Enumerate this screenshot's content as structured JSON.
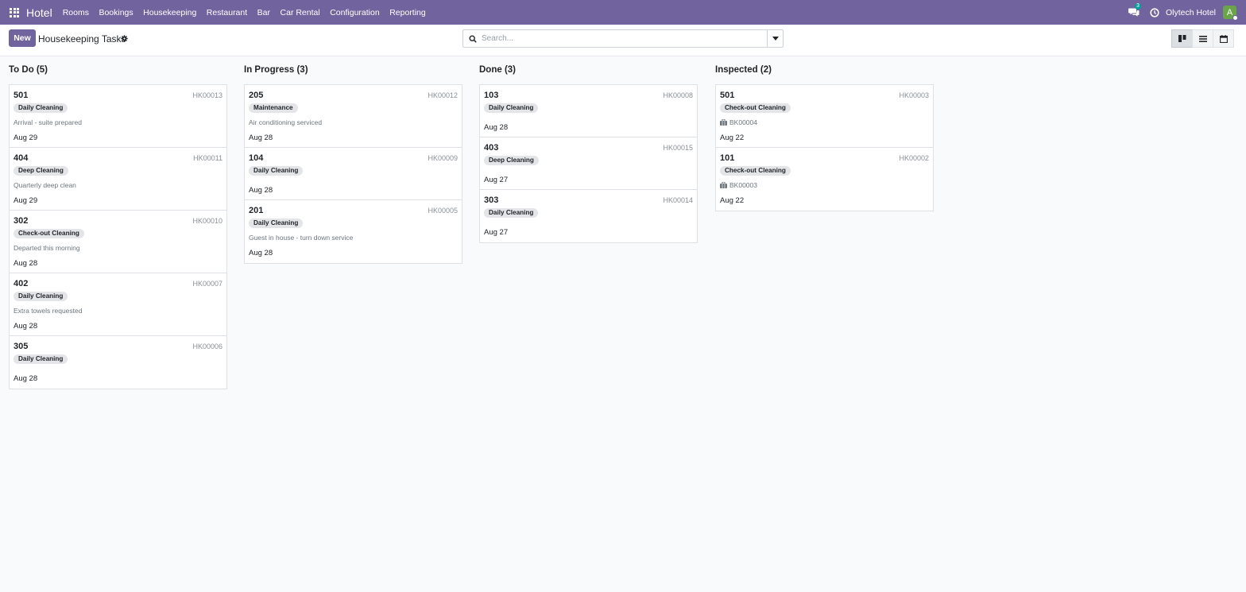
{
  "navbar": {
    "brand": "Hotel",
    "menu": [
      "Rooms",
      "Bookings",
      "Housekeeping",
      "Restaurant",
      "Bar",
      "Car Rental",
      "Configuration",
      "Reporting"
    ],
    "message_count": "3",
    "company": "Olytech Hotel",
    "avatar_letter": "A"
  },
  "control": {
    "new_label": "New",
    "title": "Housekeeping Tasks",
    "search_placeholder": "Search..."
  },
  "icons": {
    "apps": "apps-grid-icon",
    "messages": "chat-icon",
    "activity": "clock-icon",
    "settings": "gear-icon",
    "search": "search-icon",
    "toggle": "caret-down-icon",
    "views": [
      "kanban-icon",
      "list-icon",
      "calendar-icon"
    ],
    "booking": "briefcase-icon"
  },
  "colors": {
    "brand": "#71639e",
    "avatar": "#6ba54a",
    "badge": "#00a09d"
  },
  "columns": [
    {
      "title": "To Do (5)",
      "cards": [
        {
          "room": "501",
          "ref": "HK00013",
          "tag": "Daily Cleaning",
          "note": "Arrival - suite prepared",
          "date": "Aug 29"
        },
        {
          "room": "404",
          "ref": "HK00011",
          "tag": "Deep Cleaning",
          "note": "Quarterly deep clean",
          "date": "Aug 29"
        },
        {
          "room": "302",
          "ref": "HK00010",
          "tag": "Check-out Cleaning",
          "note": "Departed this morning",
          "date": "Aug 28"
        },
        {
          "room": "402",
          "ref": "HK00007",
          "tag": "Daily Cleaning",
          "note": "Extra towels requested",
          "date": "Aug 28"
        },
        {
          "room": "305",
          "ref": "HK00006",
          "tag": "Daily Cleaning",
          "date": "Aug 28"
        }
      ]
    },
    {
      "title": "In Progress (3)",
      "cards": [
        {
          "room": "205",
          "ref": "HK00012",
          "tag": "Maintenance",
          "note": "Air conditioning serviced",
          "date": "Aug 28"
        },
        {
          "room": "104",
          "ref": "HK00009",
          "tag": "Daily Cleaning",
          "date": "Aug 28"
        },
        {
          "room": "201",
          "ref": "HK00005",
          "tag": "Daily Cleaning",
          "note": "Guest in house - turn down service",
          "date": "Aug 28"
        }
      ]
    },
    {
      "title": "Done (3)",
      "cards": [
        {
          "room": "103",
          "ref": "HK00008",
          "tag": "Daily Cleaning",
          "date": "Aug 28"
        },
        {
          "room": "403",
          "ref": "HK00015",
          "tag": "Deep Cleaning",
          "date": "Aug 27"
        },
        {
          "room": "303",
          "ref": "HK00014",
          "tag": "Daily Cleaning",
          "date": "Aug 27"
        }
      ]
    },
    {
      "title": "Inspected (2)",
      "cards": [
        {
          "room": "501",
          "ref": "HK00003",
          "tag": "Check-out Cleaning",
          "booking": "BK00004",
          "date": "Aug 22"
        },
        {
          "room": "101",
          "ref": "HK00002",
          "tag": "Check-out Cleaning",
          "booking": "BK00003",
          "date": "Aug 22"
        }
      ]
    }
  ]
}
